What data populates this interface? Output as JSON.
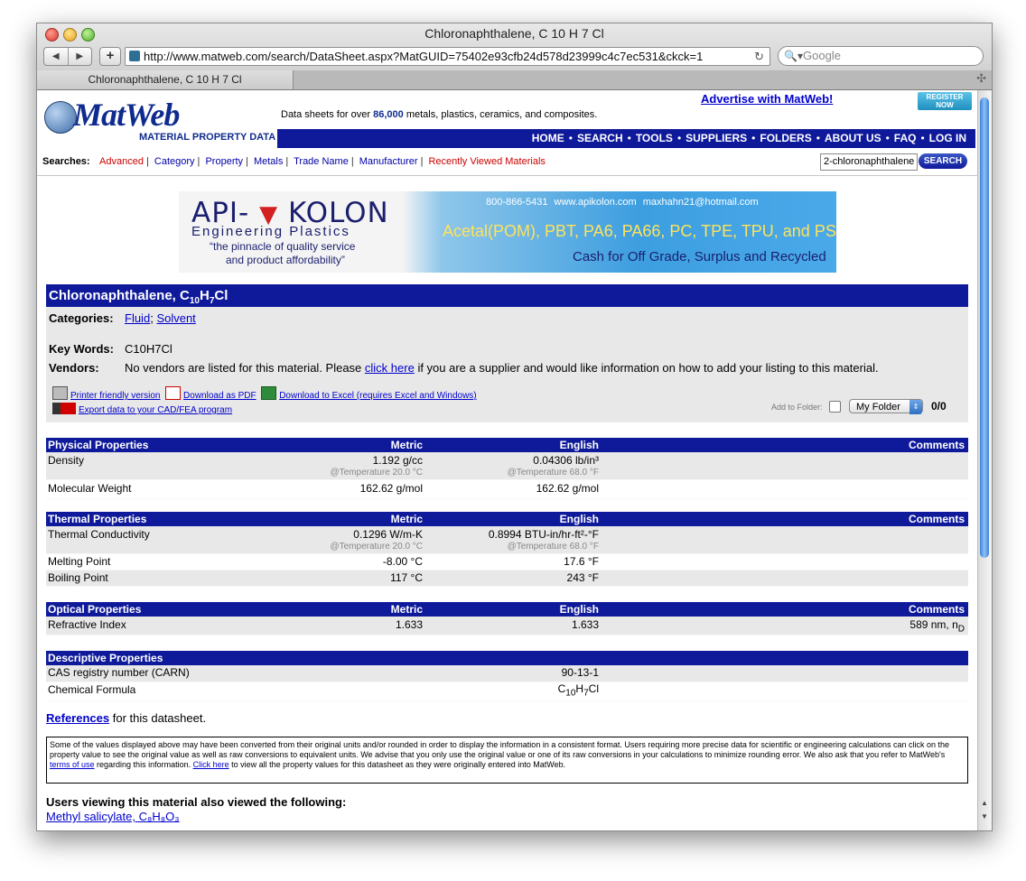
{
  "window": {
    "title": "Chloronaphthalene, C 10 H 7 Cl",
    "url": "http://www.matweb.com/search/DataSheet.aspx?MatGUID=75402e93cfb24d578d23999c4c7ec531&ckck=1",
    "search_placeholder": "Google",
    "tab_title": "Chloronaphthalene, C 10 H 7 Cl"
  },
  "header": {
    "logo_text": "MatWeb",
    "logo_sub": "MATERIAL PROPERTY DATA",
    "tagline_pre": "Data sheets for over ",
    "tagline_count": "86,000",
    "tagline_post": " metals, plastics, ceramics, and composites.",
    "advertise": "Advertise with MatWeb!",
    "register_1": "REGISTER",
    "register_2": "NOW",
    "nav": [
      "HOME",
      "SEARCH",
      "TOOLS",
      "SUPPLIERS",
      "FOLDERS",
      "ABOUT US",
      "FAQ",
      "LOG IN"
    ],
    "searches_label": "Searches:",
    "search_links": [
      "Advanced",
      "Category",
      "Property",
      "Metals",
      "Trade Name",
      "Manufacturer",
      "Recently Viewed Materials"
    ],
    "search_value": "2-chloronaphthalene",
    "search_button": "SEARCH"
  },
  "banner": {
    "brand_left": "API-",
    "brand_right": "KOLON",
    "subtitle": "Engineering Plastics",
    "quote_1": "“the pinnacle of quality service",
    "quote_2": "and product affordability”",
    "contact": "800-866-5431   www.apikolon.com   maxhahn21@hotmail.com",
    "materials": "Acetal(POM), PBT, PA6, PA66, PC, TPE, TPU, and PS",
    "cash": "Cash for Off Grade, Surplus and Recycled"
  },
  "material": {
    "name": "Chloronaphthalene, C",
    "sub1": "10",
    "mid": "H",
    "sub2": "7",
    "tail": "Cl",
    "categories_label": "Categories:",
    "category_1": "Fluid",
    "category_sep": ";",
    "category_2": "Solvent",
    "keywords_label": "Key Words:",
    "keywords": "C10H7Cl",
    "vendors_label": "Vendors:",
    "vendors_pre": "No vendors are listed for this material. Please ",
    "vendors_link": "click here",
    "vendors_post": " if you are a supplier and would like information on how to add your listing to this material.",
    "printer": "Printer friendly version",
    "pdf": "Download as PDF",
    "excel": "Download to Excel (requires Excel and Windows)",
    "cad": "Export data to your CAD/FEA program",
    "add_folder": "Add to Folder:",
    "folder": "My Folder",
    "folder_count": "0/0"
  },
  "physical": {
    "title": "Physical Properties",
    "metric": "Metric",
    "english": "English",
    "comments": "Comments",
    "density": "Density",
    "density_m": "1.192 g/cc",
    "density_e": "0.04306 lb/in³",
    "density_cm": "@Temperature 20.0 °C",
    "density_ce": "@Temperature 68.0 °F",
    "mw": "Molecular Weight",
    "mw_m": "162.62 g/mol",
    "mw_e": "162.62 g/mol"
  },
  "thermal": {
    "title": "Thermal Properties",
    "metric": "Metric",
    "english": "English",
    "comments": "Comments",
    "tc": "Thermal Conductivity",
    "tc_m": "0.1296 W/m-K",
    "tc_e": "0.8994 BTU-in/hr-ft²-°F",
    "tc_cm": "@Temperature 20.0 °C",
    "tc_ce": "@Temperature 68.0 °F",
    "mp": "Melting Point",
    "mp_m": "-8.00 °C",
    "mp_e": "17.6 °F",
    "bp": "Boiling Point",
    "bp_m": "117 °C",
    "bp_e": "243 °F"
  },
  "optical": {
    "title": "Optical Properties",
    "metric": "Metric",
    "english": "English",
    "comments": "Comments",
    "ri": "Refractive Index",
    "ri_m": "1.633",
    "ri_e": "1.633",
    "ri_c": "589 nm, n",
    "ri_c_sub": "D"
  },
  "descriptive": {
    "title": "Descriptive Properties",
    "cas": "CAS registry number (CARN)",
    "cas_v": "90-13-1",
    "formula": "Chemical Formula",
    "f_c": "C",
    "f_1": "10",
    "f_h": "H",
    "f_2": "7",
    "f_cl": "Cl"
  },
  "footer": {
    "references": "References",
    "references_post": " for this datasheet.",
    "disclaimer_1": "Some of the values displayed above may have been converted from their original units and/or rounded in order to display the information in a consistent format. Users requiring more precise data for scientific or engineering calculations can click on the property value to see the original value as well as raw conversions to equivalent units. We advise that you only use the original value or one of its raw conversions in your calculations to minimize rounding error. We also ask that you refer to MatWeb's ",
    "terms": "terms of use",
    "disclaimer_2": " regarding this information. ",
    "click_here": "Click here",
    "disclaimer_3": " to view all the property values for this datasheet as they were originally entered into MatWeb.",
    "also_viewed": "Users viewing this material also viewed the following:",
    "also_link": "Methyl salicylate, C₈H₈O₃"
  }
}
